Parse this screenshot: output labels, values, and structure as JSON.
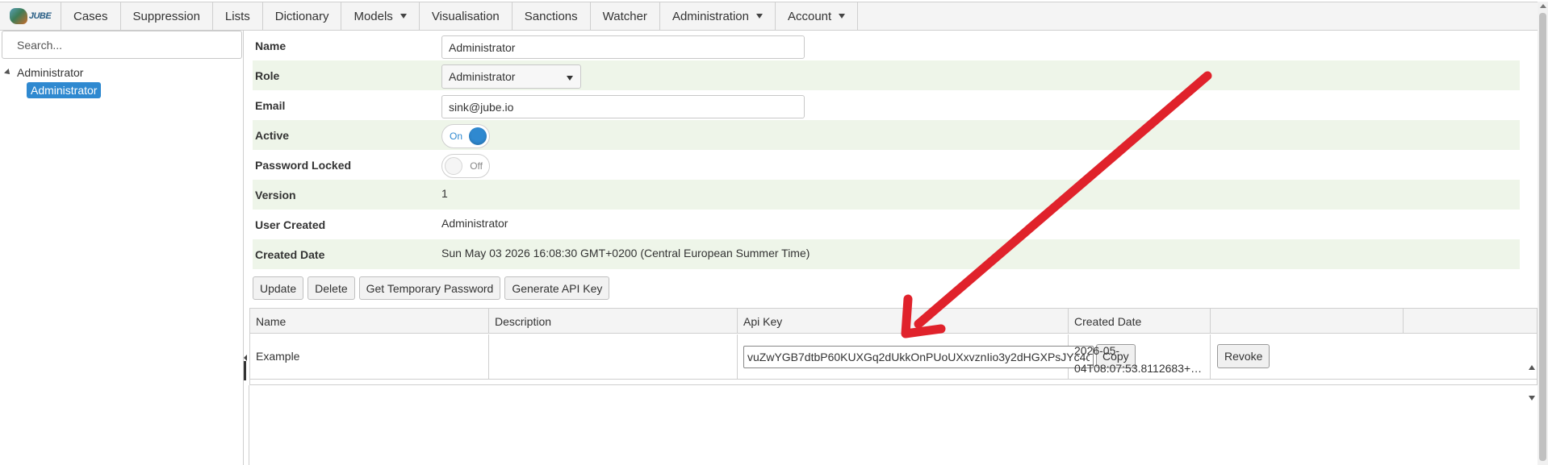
{
  "app": {
    "logo_text": "JUBE"
  },
  "nav": [
    {
      "label": "Cases",
      "has_menu": false
    },
    {
      "label": "Suppression",
      "has_menu": false
    },
    {
      "label": "Lists",
      "has_menu": false
    },
    {
      "label": "Dictionary",
      "has_menu": false
    },
    {
      "label": "Models",
      "has_menu": true
    },
    {
      "label": "Visualisation",
      "has_menu": false
    },
    {
      "label": "Sanctions",
      "has_menu": false
    },
    {
      "label": "Watcher",
      "has_menu": false
    },
    {
      "label": "Administration",
      "has_menu": true
    },
    {
      "label": "Account",
      "has_menu": true
    }
  ],
  "sidebar": {
    "search_placeholder": "Search...",
    "tree": {
      "root": "Administrator",
      "selected": "Administrator"
    }
  },
  "form": {
    "name": {
      "label": "Name",
      "value": "Administrator"
    },
    "role": {
      "label": "Role",
      "value": "Administrator"
    },
    "email": {
      "label": "Email",
      "value": "sink@jube.io"
    },
    "active": {
      "label": "Active",
      "state": "On"
    },
    "password_locked": {
      "label": "Password Locked",
      "state": "Off"
    },
    "version": {
      "label": "Version",
      "value": "1"
    },
    "user_created": {
      "label": "User Created",
      "value": "Administrator"
    },
    "created_date": {
      "label": "Created Date",
      "value": "Sun May 03 2026 16:08:30 GMT+0200 (Central European Summer Time)"
    }
  },
  "actions": {
    "update": "Update",
    "delete": "Delete",
    "temp_password": "Get Temporary Password",
    "generate_api_key": "Generate API Key"
  },
  "api_keys": {
    "headers": {
      "name": "Name",
      "description": "Description",
      "api_key": "Api Key",
      "created_date": "Created Date"
    },
    "rows": [
      {
        "name": "Example",
        "description": "",
        "api_key": "vuZwYGB7dtbP60KUXGq2dUkkOnPUoUXxvznIio3y2dHGXPsJYc4c",
        "copy_label": "Copy",
        "created_date_line1": "2026-05-",
        "created_date_line2": "04T08:07:53.8112683+…",
        "revoke_label": "Revoke"
      }
    ]
  },
  "colors": {
    "accent": "#2f89d0",
    "row_alt": "#eef5e9",
    "annotation_arrow": "#e0222b"
  }
}
